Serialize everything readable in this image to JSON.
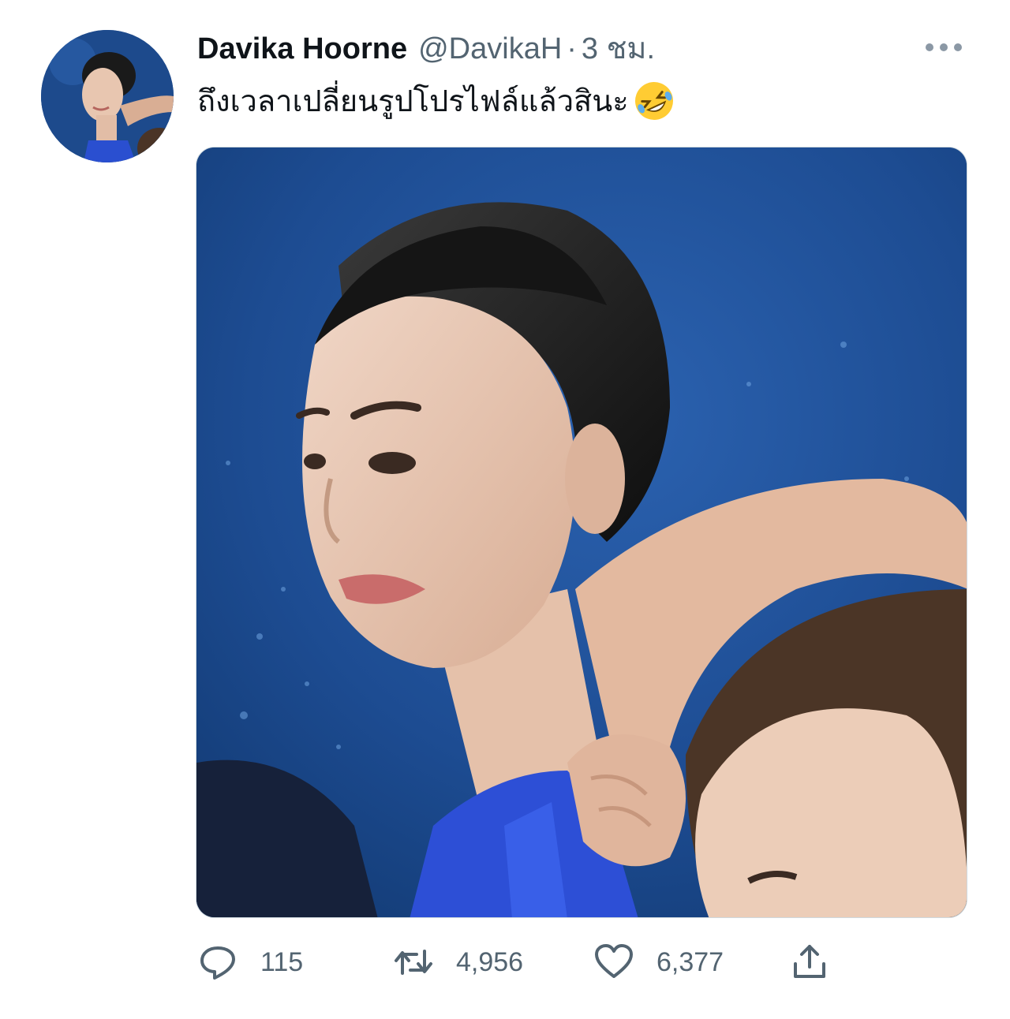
{
  "tweet": {
    "display_name": "Davika Hoorne",
    "handle": "@DavikaH",
    "separator": "·",
    "timestamp": "3 ชม.",
    "text": "ถึงเวลาเปลี่ยนรูปโปรไฟล์แล้วสินะ",
    "emoji": "rolling-on-the-floor-laughing-emoji"
  },
  "actions": {
    "reply_count": "115",
    "retweet_count": "4,956",
    "like_count": "6,377"
  },
  "icons": {
    "more": "more-horizontal-icon",
    "reply": "reply-icon",
    "retweet": "retweet-icon",
    "like": "heart-icon",
    "share": "share-icon"
  },
  "colors": {
    "text_primary": "#0f1419",
    "text_secondary": "#536471",
    "photo_background": "#1f4f96"
  }
}
